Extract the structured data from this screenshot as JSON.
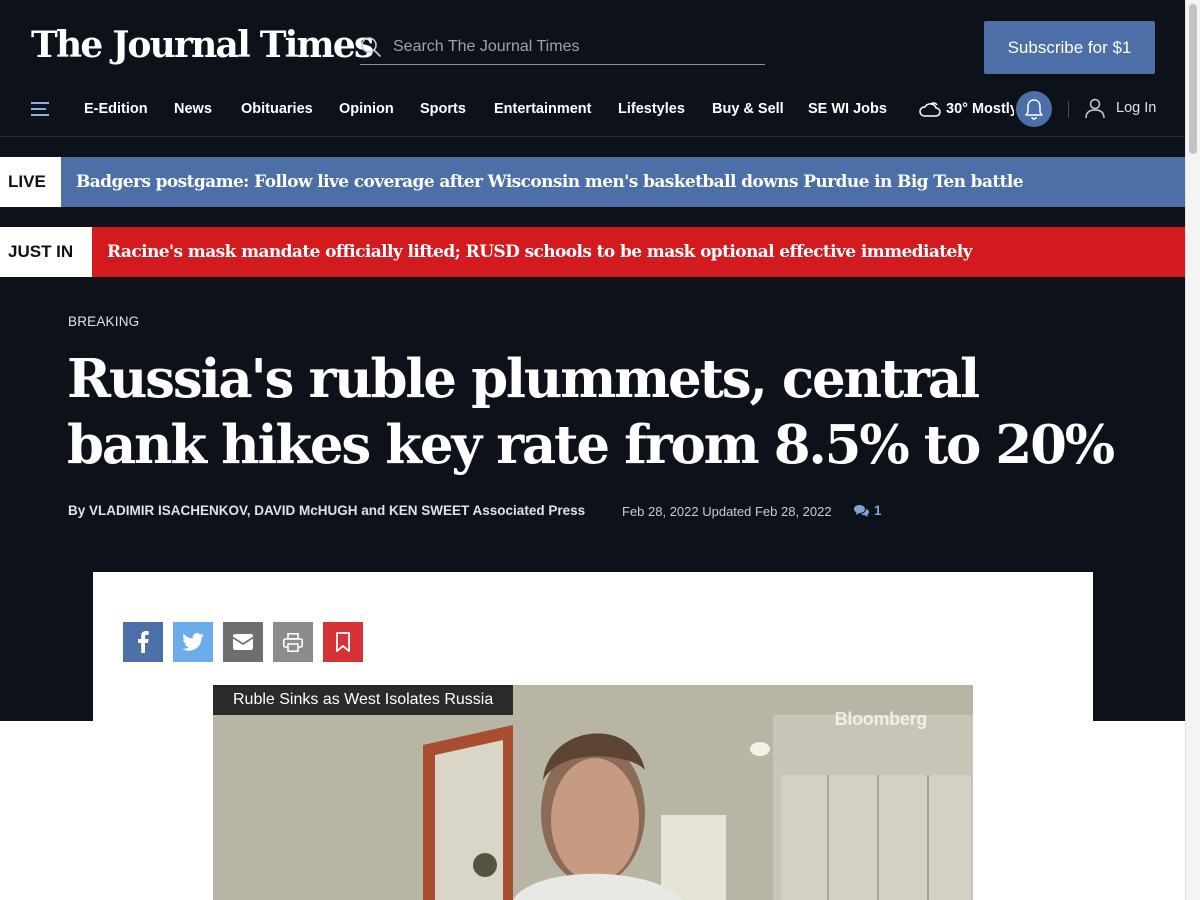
{
  "header": {
    "logo": "The Journal Times",
    "search_placeholder": "Search The Journal Times",
    "subscribe_label": "Subscribe for $1"
  },
  "nav": {
    "items": [
      "E-Edition",
      "News",
      "Obituaries",
      "Opinion",
      "Sports",
      "Entertainment",
      "Lifestyles",
      "Buy & Sell",
      "SE WI Jobs"
    ],
    "weather": "30° Mostly",
    "login_label": "Log In"
  },
  "banners": {
    "live": {
      "tag": "LIVE",
      "text": "Badgers postgame: Follow live coverage after Wisconsin men's basketball downs Purdue in Big Ten battle"
    },
    "just_in": {
      "tag": "JUST IN",
      "text": "Racine's mask mandate officially lifted; RUSD schools to be mask optional effective immediately"
    }
  },
  "article": {
    "kicker": "BREAKING",
    "headline": "Russia's ruble plummets, central bank hikes key rate from 8.5% to 20%",
    "byline": "By VLADIMIR ISACHENKOV, DAVID McHUGH and KEN SWEET Associated Press",
    "dates": "Feb 28, 2022 Updated Feb 28, 2022",
    "comment_count": "1"
  },
  "share_buttons": [
    "facebook-icon",
    "twitter-icon",
    "email-icon",
    "print-icon",
    "bookmark-icon"
  ],
  "video": {
    "title": "Ruble Sinks as West Isolates Russia",
    "brand_watermark": "Bloomberg"
  },
  "colors": {
    "page_dark": "#0d111a",
    "accent_blue": "#4b6fa6",
    "breaking_red": "#d21a1f",
    "twitter_blue": "#6cacea",
    "bookmark_red": "#d53235"
  }
}
